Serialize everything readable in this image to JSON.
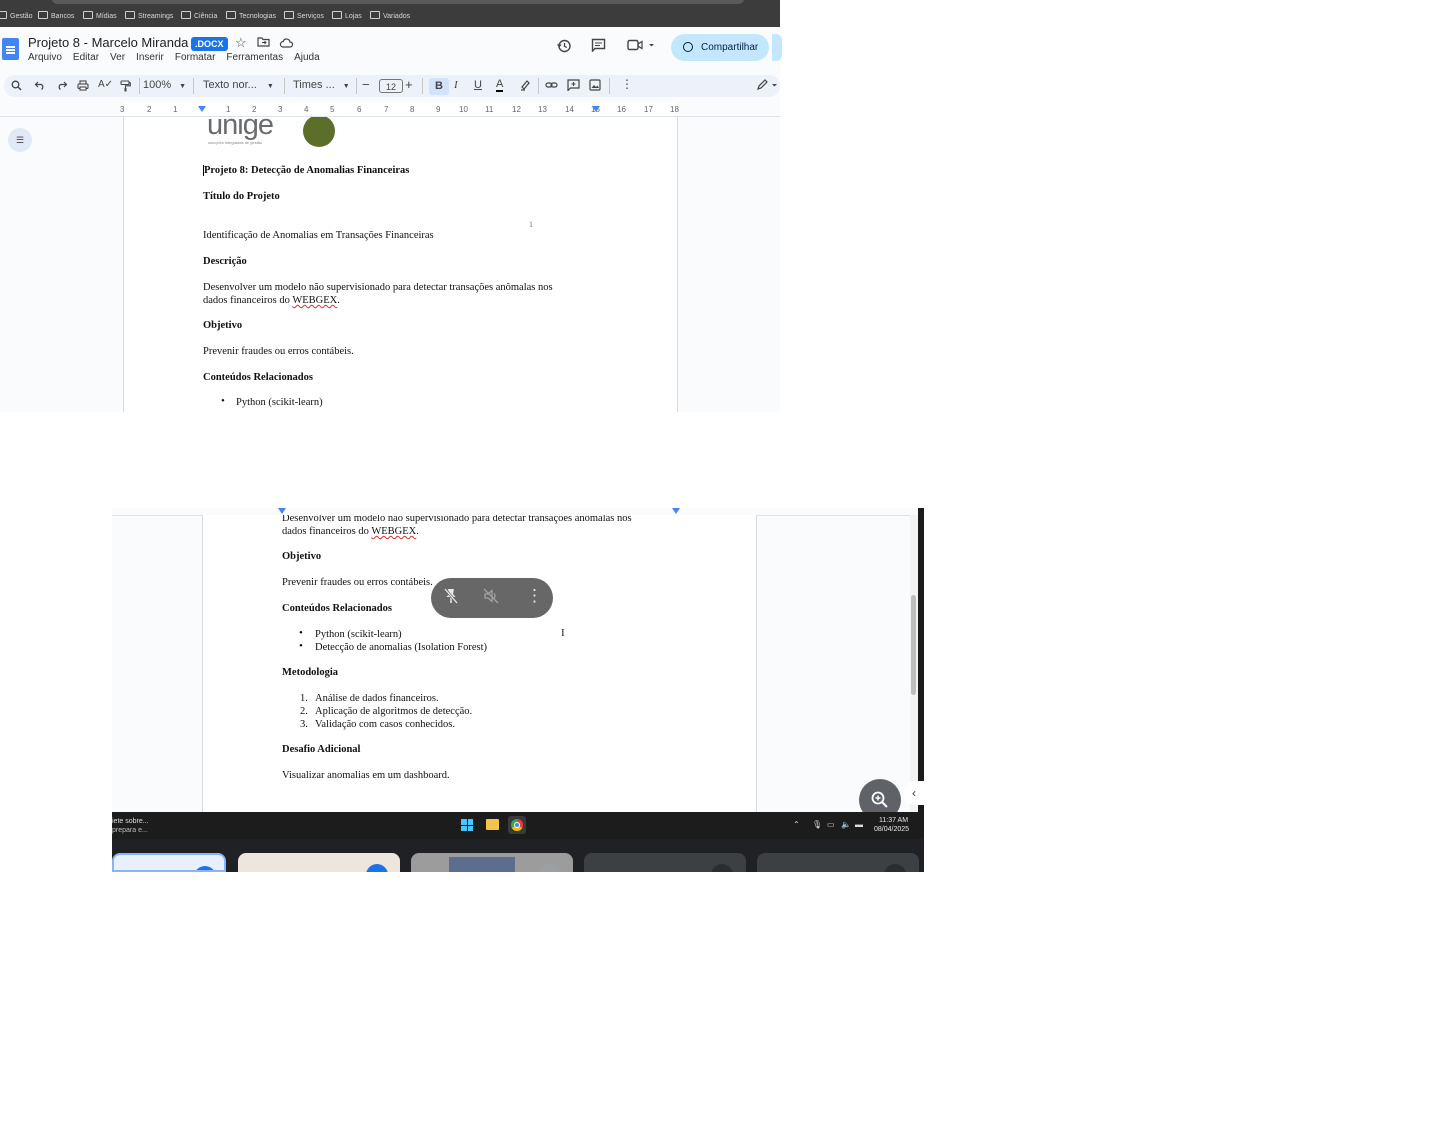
{
  "bookmarks": [
    "Gestão",
    "Bancos",
    "Mídias",
    "Streamings",
    "Ciência",
    "Tecnologias",
    "Serviços",
    "Lojas",
    "Variados"
  ],
  "doc": {
    "title": "Projeto 8 - Marcelo Miranda",
    "badge": ".DOCX",
    "menu": [
      "Arquivo",
      "Editar",
      "Ver",
      "Inserir",
      "Formatar",
      "Ferramentas",
      "Ajuda"
    ],
    "share_label": "Compartilhar"
  },
  "toolbar": {
    "zoom": "100%",
    "style": "Texto nor...",
    "font": "Times ...",
    "font_size": "12",
    "bold": "B",
    "italic": "I",
    "underline": "U",
    "text_color": "A"
  },
  "ruler": [
    "3",
    "2",
    "1",
    "1",
    "2",
    "3",
    "4",
    "5",
    "6",
    "7",
    "8",
    "9",
    "10",
    "11",
    "12",
    "13",
    "14",
    "15",
    "16",
    "17",
    "18"
  ],
  "content": {
    "logo_text": "unige",
    "logo_tagline": "soluções integradas de gestão",
    "heading": "Projeto 8: Detecção de Anomalias Financeiras",
    "title_label": "Título do Projeto",
    "title_text": "Identificação de Anomalias em Transações Financeiras",
    "page_marker": "1",
    "desc_label": "Descrição",
    "desc_text_1": "Desenvolver um modelo não supervisionado para detectar transações anômalas nos",
    "desc_text_2a": "dados financeiros do ",
    "desc_text_2b": "WEBGEX",
    "desc_text_2c": ".",
    "obj_label": "Objetivo",
    "obj_text": "Prevenir fraudes ou erros contábeis.",
    "rel_label": "Conteúdos Relacionados",
    "rel_items": [
      "Python (scikit-learn)",
      "Detecção de anomalias (Isolation Forest)"
    ],
    "method_label": "Metodologia",
    "method_items": [
      "Análise de dados financeiros.",
      "Aplicação de algoritmos de detecção.",
      "Validação com casos conhecidos."
    ],
    "challenge_label": "Desafio Adicional",
    "challenge_text": "Visualizar anomalias em um dashboard."
  },
  "taskbar": {
    "notif_1": "iete sobre...",
    "notif_2": "prepara e...",
    "time": "11:37 AM",
    "date": "08/04/2025"
  },
  "colors": {
    "accent": "#1a73e8",
    "share_bg": "#c2e7ff",
    "toolbar_bg": "#edf2fa",
    "logo_green": "#5b6e2a"
  },
  "icons": [
    "docs-logo-icon",
    "star-icon",
    "move-folder-icon",
    "cloud-status-icon",
    "history-icon",
    "comments-icon",
    "meet-icon",
    "globe-icon",
    "search-icon",
    "undo-icon",
    "redo-icon",
    "print-icon",
    "spellcheck-icon",
    "paint-format-icon",
    "highlight-icon",
    "link-icon",
    "add-comment-icon",
    "image-icon",
    "more-icon",
    "edit-pencil-icon",
    "outline-icon",
    "pin-off-icon",
    "mute-icon",
    "zoom-in-icon",
    "windows-start-icon",
    "file-explorer-icon",
    "chrome-icon"
  ]
}
